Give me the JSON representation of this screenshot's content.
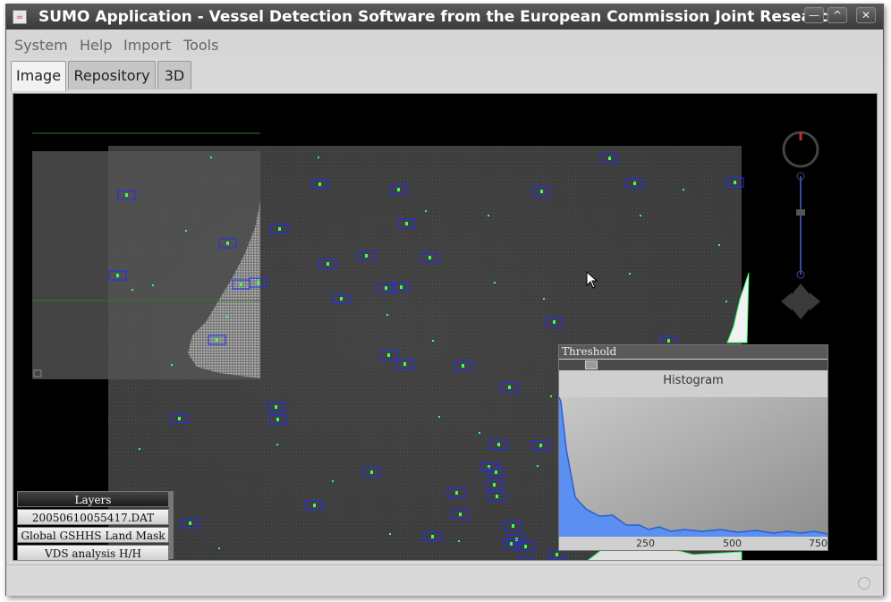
{
  "window": {
    "title": "SUMO Application - Vessel Detection Software from the European Commission Joint Research",
    "controls": {
      "minimize": "—",
      "maximize": "^",
      "close": "✕"
    }
  },
  "menu": [
    "System",
    "Help",
    "Import",
    "Tools"
  ],
  "tabs": [
    {
      "label": "Image",
      "active": true
    },
    {
      "label": "Repository",
      "active": false
    },
    {
      "label": "3D",
      "active": false
    }
  ],
  "layers": {
    "header": "Layers",
    "items": [
      "20050610055417.DAT",
      "Global GSHHS Land Mask",
      "VDS analysis H/H"
    ]
  },
  "threshold": {
    "title": "Threshold",
    "histogram_title": "Histogram",
    "x_ticks": [
      "250",
      "500",
      "750"
    ],
    "slider_level": 0.1
  },
  "colors": {
    "detection_box": "#1f2cff",
    "detection_point": "#38ff6a",
    "histogram_fill": "#5b8ff0",
    "histogram_line": "#2a5fd0"
  },
  "icons": {
    "app": "java-cup-icon",
    "compass": "compass-icon",
    "pan": "pan-arrows-icon",
    "zoom": "zoom-slider-icon",
    "overview_toggle": "overview-toggle-icon",
    "status": "status-indicator-icon"
  }
}
